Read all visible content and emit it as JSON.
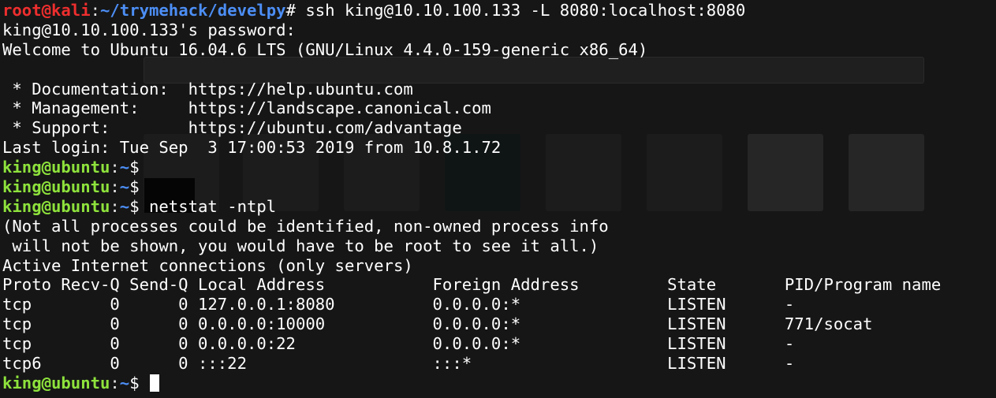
{
  "background_color": "#161616",
  "prompt_colors": {
    "user_host_root": "#ef2e2e",
    "path": "#4c8ef5",
    "user_host_remote": "#8ee23c"
  },
  "kali_prompt": {
    "user_host": "root@kali",
    "sep": ":",
    "path": "~/trymehack/develpy",
    "symbol": "#",
    "command": " ssh king@10.10.100.133 -L 8080:localhost:8080"
  },
  "ssh": {
    "password_prompt": "king@10.10.100.133's password:",
    "welcome": "Welcome to Ubuntu 16.04.6 LTS (GNU/Linux 4.4.0-159-generic x86_64)"
  },
  "motd": [
    " * Documentation:  https://help.ubuntu.com",
    " * Management:     https://landscape.canonical.com",
    " * Support:        https://ubuntu.com/advantage"
  ],
  "last_login": "Last login: Tue Sep  3 17:00:53 2019 from 10.8.1.72",
  "remote_prompt": {
    "user_host": "king@ubuntu",
    "sep": ":",
    "path": "~",
    "symbol": "$"
  },
  "commands": [
    "",
    "",
    " netstat -ntpl"
  ],
  "netstat_notice": [
    "(Not all processes could be identified, non-owned process info",
    " will not be shown, you would have to be root to see it all.)"
  ],
  "netstat_title": "Active Internet connections (only servers)",
  "netstat_header": "Proto Recv-Q Send-Q Local Address           Foreign Address         State       PID/Program name",
  "netstat_rows": [
    "tcp        0      0 127.0.0.1:8080          0.0.0.0:*               LISTEN      -",
    "tcp        0      0 0.0.0.0:10000           0.0.0.0:*               LISTEN      771/socat",
    "tcp        0      0 0.0.0.0:22              0.0.0.0:*               LISTEN      -",
    "tcp6       0      0 :::22                   :::*                    LISTEN      -"
  ],
  "final_command": " "
}
